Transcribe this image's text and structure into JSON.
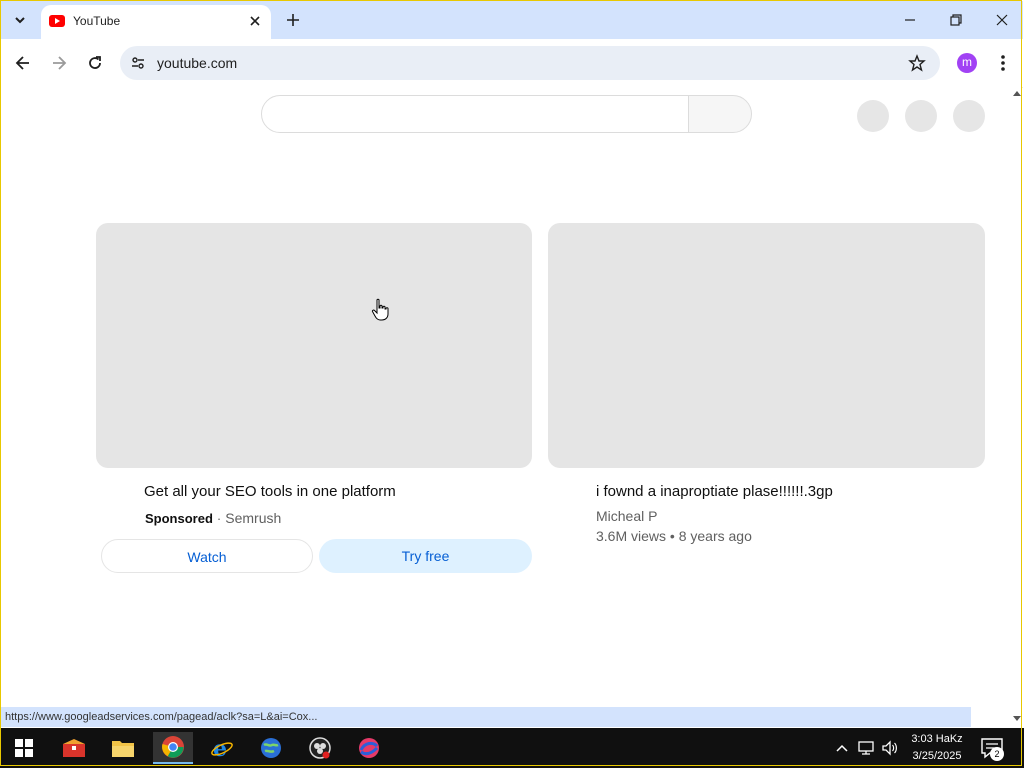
{
  "browser": {
    "tab_title": "YouTube",
    "url": "youtube.com",
    "profile_initial": "m",
    "status_url": "https://www.googleadservices.com/pagead/aclk?sa=L&ai=Cox..."
  },
  "youtube": {
    "ad": {
      "title": "Get all your SEO tools in one platform",
      "sponsored_label": "Sponsored",
      "separator": "·",
      "advertiser": "Semrush",
      "watch_label": "Watch",
      "try_label": "Try free"
    },
    "video": {
      "title": "i fownd a inaproptiate plase!!!!!!.3gp",
      "channel": "Micheal P",
      "stats": "3.6M views • 8 years ago"
    }
  },
  "taskbar": {
    "time": "3:03 HaKz",
    "date": "3/25/2025",
    "notification_count": "2"
  },
  "colors": {
    "tab_strip": "#d3e3fd",
    "youtube_red": "#ff0000",
    "link_blue": "#065fd4",
    "try_free_bg": "#def1ff",
    "profile": "#a142f4"
  }
}
